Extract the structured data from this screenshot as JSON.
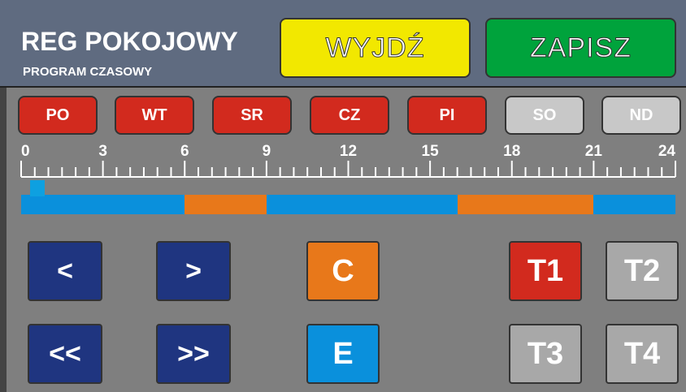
{
  "header": {
    "title": "REG POKOJOWY",
    "subtitle": "PROGRAM CZASOWY",
    "exit_label": "WYJDŹ",
    "save_label": "ZAPISZ",
    "exit_color": "#f2e800",
    "save_color": "#00a33c"
  },
  "days": [
    {
      "label": "PO",
      "active": true,
      "color": "#d22a1e"
    },
    {
      "label": "WT",
      "active": true,
      "color": "#d22a1e"
    },
    {
      "label": "SR",
      "active": true,
      "color": "#d22a1e"
    },
    {
      "label": "CZ",
      "active": true,
      "color": "#d22a1e"
    },
    {
      "label": "PI",
      "active": true,
      "color": "#d22a1e"
    },
    {
      "label": "SO",
      "active": false,
      "color": "#c8c8c8"
    },
    {
      "label": "ND",
      "active": false,
      "color": "#c8c8c8"
    }
  ],
  "ruler": {
    "hour_labels": [
      "0",
      "3",
      "6",
      "9",
      "12",
      "15",
      "18",
      "21",
      "24"
    ],
    "max_hours": 24
  },
  "schedule": {
    "cursor_hour": 0.5,
    "segments": [
      {
        "from": 0,
        "to": 6,
        "mode": "E",
        "color": "#0a90dc"
      },
      {
        "from": 6,
        "to": 9,
        "mode": "C",
        "color": "#e8781a"
      },
      {
        "from": 9,
        "to": 16,
        "mode": "E",
        "color": "#0a90dc"
      },
      {
        "from": 16,
        "to": 21,
        "mode": "C",
        "color": "#e8781a"
      },
      {
        "from": 21,
        "to": 24,
        "mode": "E",
        "color": "#0a90dc"
      }
    ]
  },
  "controls": {
    "prev": "<",
    "next": ">",
    "prev_fast": "<<",
    "next_fast": ">>",
    "comfort": "C",
    "comfort_color": "#e8781a",
    "eco": "E",
    "eco_color": "#0a90dc",
    "t1": "T1",
    "t2": "T2",
    "t3": "T3",
    "t4": "T4",
    "t_active_color": "#d22a1e",
    "t_inactive_color": "#a8a8a8"
  }
}
